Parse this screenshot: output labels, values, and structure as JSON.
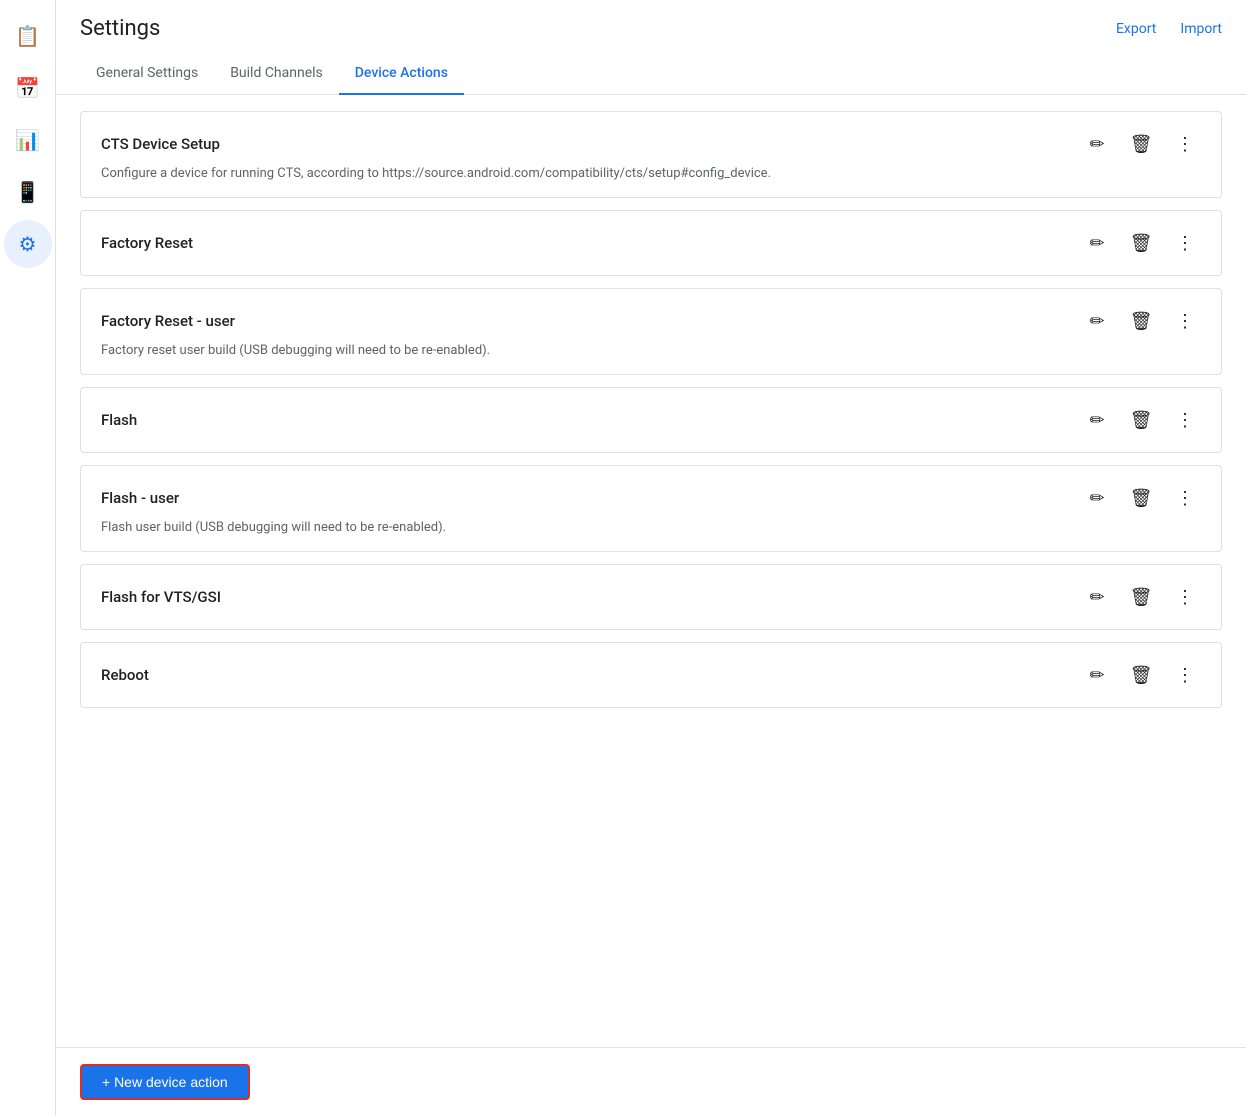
{
  "header": {
    "title": "Settings",
    "export_label": "Export",
    "import_label": "Import"
  },
  "tabs": [
    {
      "id": "general",
      "label": "General Settings",
      "active": false
    },
    {
      "id": "build",
      "label": "Build Channels",
      "active": false
    },
    {
      "id": "device",
      "label": "Device Actions",
      "active": true
    }
  ],
  "actions": [
    {
      "name": "CTS Device Setup",
      "description": "Configure a device for running CTS, according to https://source.android.com/compatibility/cts/setup#config_device."
    },
    {
      "name": "Factory Reset",
      "description": ""
    },
    {
      "name": "Factory Reset - user",
      "description": "Factory reset user build (USB debugging will need to be re-enabled)."
    },
    {
      "name": "Flash",
      "description": ""
    },
    {
      "name": "Flash - user",
      "description": "Flash user build (USB debugging will need to be re-enabled)."
    },
    {
      "name": "Flash for VTS/GSI",
      "description": ""
    },
    {
      "name": "Reboot",
      "description": ""
    }
  ],
  "sidebar": {
    "items": [
      {
        "id": "clipboard",
        "icon": "📋",
        "active": false
      },
      {
        "id": "calendar",
        "icon": "📅",
        "active": false
      },
      {
        "id": "chart",
        "icon": "📊",
        "active": false
      },
      {
        "id": "phone",
        "icon": "📱",
        "active": false
      },
      {
        "id": "settings",
        "icon": "⚙",
        "active": true
      }
    ]
  },
  "bottom": {
    "new_action_label": "+ New device action"
  }
}
